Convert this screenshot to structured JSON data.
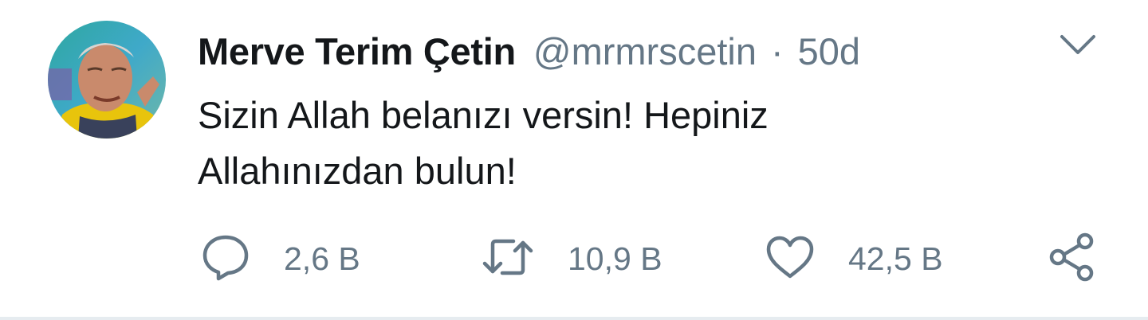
{
  "tweet": {
    "author_name": "Merve Terim Çetin",
    "handle": "@mrmrscetin",
    "separator": "·",
    "time": "50d",
    "text_lines": [
      "Sizin Allah belanızı versin! Hepiniz",
      "Allahınızdan bulun!"
    ]
  },
  "actions": {
    "reply": {
      "icon": "reply-icon",
      "count": "2,6 B"
    },
    "retweet": {
      "icon": "retweet-icon",
      "count": "10,9 B"
    },
    "like": {
      "icon": "heart-icon",
      "count": "42,5 B"
    },
    "share": {
      "icon": "share-icon"
    }
  },
  "colors": {
    "text": "#14171a",
    "secondary": "#657786",
    "divider": "#e6ecf0",
    "background": "#ffffff"
  }
}
